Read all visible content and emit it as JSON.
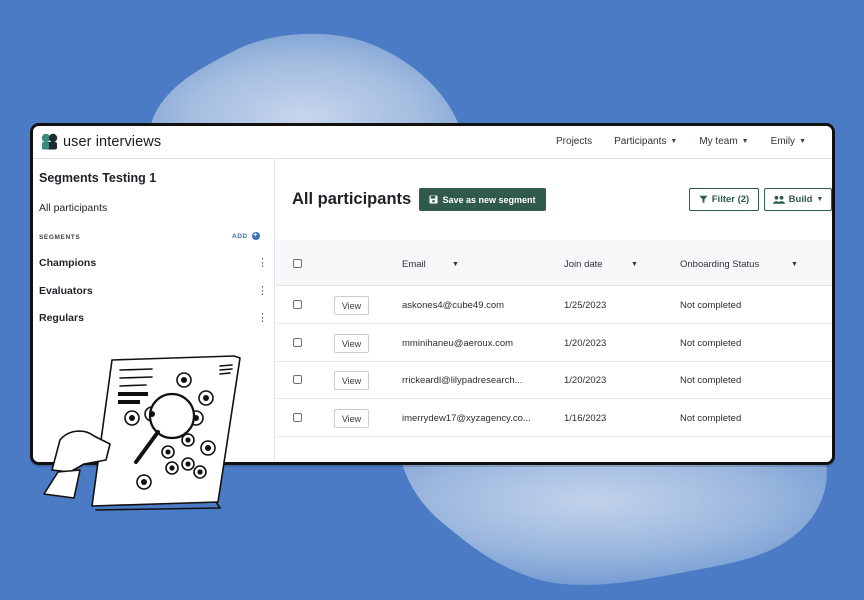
{
  "topbar": {
    "brand": "user interviews",
    "nav": [
      {
        "label": "Projects",
        "caret": false
      },
      {
        "label": "Participants",
        "caret": true
      },
      {
        "label": "My team",
        "caret": true
      },
      {
        "label": "Emily",
        "caret": true
      }
    ]
  },
  "sidebar": {
    "title": "Segments Testing 1",
    "all_participants": "All participants",
    "segments_heading": "SEGMENTS",
    "add_label": "ADD",
    "segments": [
      "Champions",
      "Evaluators",
      "Regulars"
    ]
  },
  "main": {
    "title": "All participants",
    "save_button": "Save as new segment",
    "filter_button": "Filter (2)",
    "build_button": "Build",
    "columns": {
      "email": "Email",
      "join_date": "Join date",
      "onboarding": "Onboarding Status"
    },
    "view_label": "View",
    "rows": [
      {
        "email": "askones4@cube49.com",
        "join_date": "1/25/2023",
        "status": "Not completed"
      },
      {
        "email": "mminihaneu@aeroux.com",
        "join_date": "1/20/2023",
        "status": "Not completed"
      },
      {
        "email": "rrickeardl@lilypadresearch...",
        "join_date": "1/20/2023",
        "status": "Not completed"
      },
      {
        "email": "imerrydew17@xyzagency.co...",
        "join_date": "1/16/2023",
        "status": "Not completed"
      }
    ]
  },
  "colors": {
    "background": "#4a7bc4",
    "primary_green": "#2f5a4c",
    "accent_blue": "#3b6fb8"
  }
}
